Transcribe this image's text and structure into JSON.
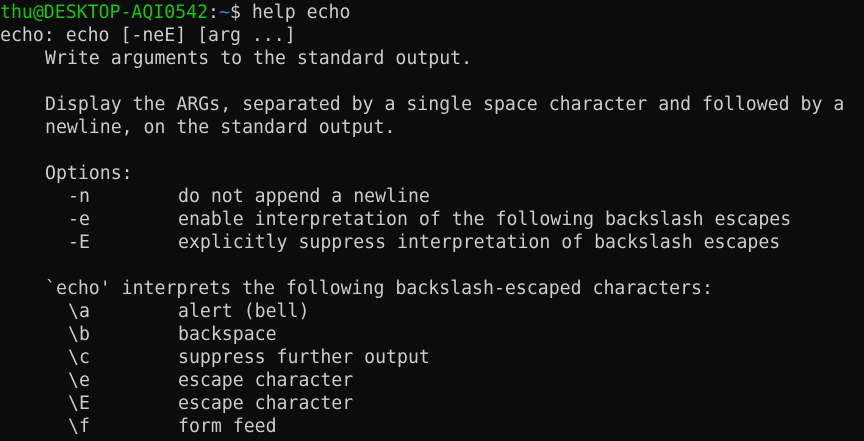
{
  "prompt": {
    "user_host": "thu@DESKTOP-AQI0542",
    "separator": ":",
    "path": "~",
    "symbol": "$",
    "command": "help echo"
  },
  "help": {
    "usage": "echo: echo [-neE] [arg ...]",
    "summary": "Write arguments to the standard output.",
    "description_1": "Display the ARGs, separated by a single space character and followed by a",
    "description_2": "newline, on the standard output.",
    "options_header": "Options:",
    "options": [
      {
        "flag": "-n",
        "desc": "do not append a newline"
      },
      {
        "flag": "-e",
        "desc": "enable interpretation of the following backslash escapes"
      },
      {
        "flag": "-E",
        "desc": "explicitly suppress interpretation of backslash escapes"
      }
    ],
    "escapes_header": "`echo' interprets the following backslash-escaped characters:",
    "escapes": [
      {
        "code": "\\a",
        "desc": "alert (bell)"
      },
      {
        "code": "\\b",
        "desc": "backspace"
      },
      {
        "code": "\\c",
        "desc": "suppress further output"
      },
      {
        "code": "\\e",
        "desc": "escape character"
      },
      {
        "code": "\\E",
        "desc": "escape character"
      },
      {
        "code": "\\f",
        "desc": "form feed"
      }
    ]
  },
  "colors": {
    "background": "#0c0c0c",
    "foreground": "#cccccc",
    "prompt_user": "#16c60c",
    "prompt_path": "#3b78ff"
  }
}
